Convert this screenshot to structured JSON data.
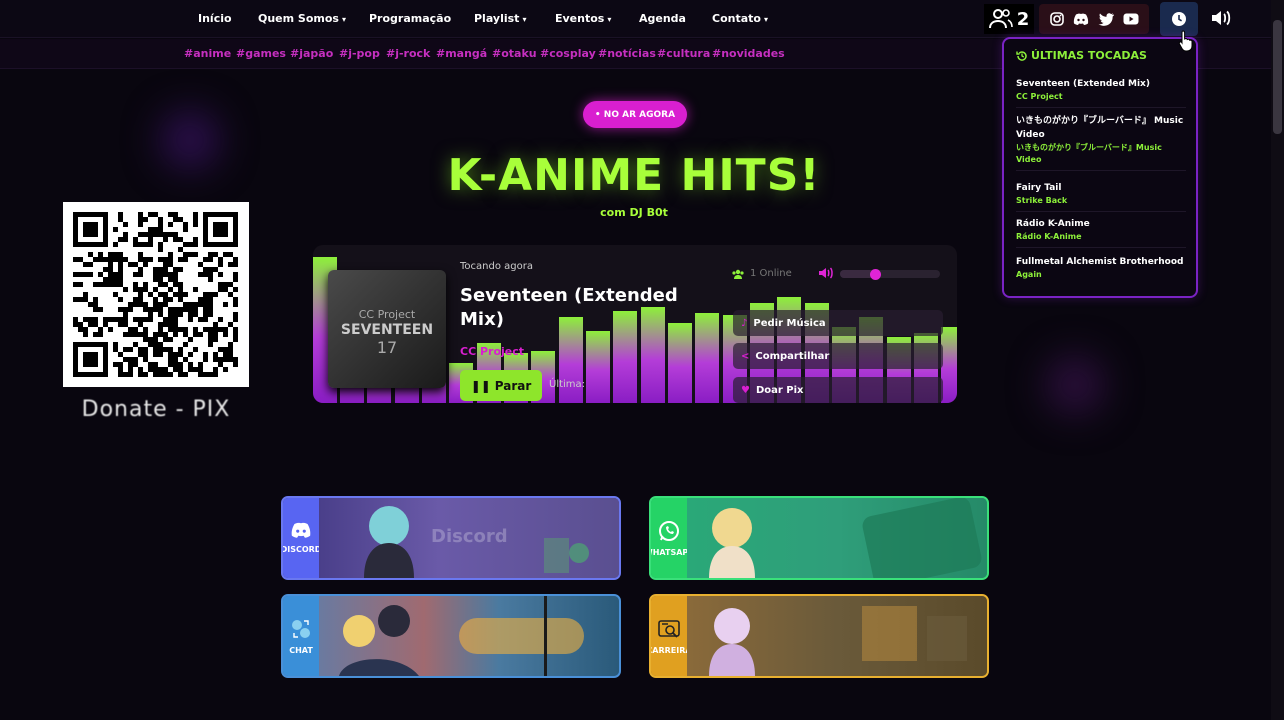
{
  "nav": {
    "items": [
      {
        "label": "Início",
        "dropdown": false
      },
      {
        "label": "Quem Somos",
        "dropdown": true
      },
      {
        "label": "Programação",
        "dropdown": false
      },
      {
        "label": "Playlist",
        "dropdown": true
      },
      {
        "label": "Eventos",
        "dropdown": true
      },
      {
        "label": "Agenda",
        "dropdown": false
      },
      {
        "label": "Contato",
        "dropdown": true
      }
    ],
    "listeners_count": "2",
    "social": [
      "instagram-icon",
      "discord-icon",
      "twitter-icon",
      "youtube-icon"
    ]
  },
  "tags": [
    "#anime",
    "#games",
    "#japão",
    "#j-pop",
    "#j-rock",
    "#mangá",
    "#otaku",
    "#cosplay",
    "#notícias",
    "#cultura",
    "#novidades"
  ],
  "hero": {
    "live_badge": "• NO AR AGORA",
    "title": "K-ANIME HITS!",
    "subtitle": "com DJ B0t"
  },
  "donate": {
    "label": "Donate - PIX"
  },
  "player": {
    "now_playing_label": "Tocando agora",
    "song_title": "Seventeen (Extended Mix)",
    "song_artist": "CC Project",
    "stop_button": "Parar",
    "last_label": "Última:",
    "online": "1 Online",
    "volume": 0.35,
    "cover": {
      "brand": "CC Project",
      "title": "SEVENTEEN",
      "number": "17"
    },
    "buttons": [
      {
        "label": "Pedir Música",
        "icon": "music-request-icon"
      },
      {
        "label": "Compartilhar",
        "icon": "share-icon"
      },
      {
        "label": "Doar Pix",
        "icon": "heart-icon"
      }
    ]
  },
  "history": {
    "title": "ÚLTIMAS TOCADAS",
    "items": [
      {
        "song": "Seventeen (Extended Mix)",
        "artist": "CC Project"
      },
      {
        "song": "いきものがかり『ブルーバード』 Music Video",
        "artist": "いきものがかり『ブルーバード』Music Video"
      },
      {
        "song": "Fairy Tail",
        "artist": "Strike Back"
      },
      {
        "song": "Rádio K-Anime",
        "artist": "Rádio K-Anime"
      },
      {
        "song": "Fullmetal Alchemist Brotherhood",
        "artist": "Again"
      }
    ]
  },
  "cards": [
    {
      "label": "DISCORD",
      "watermark": "Discord",
      "icon": "discord-icon",
      "color": "#5865f2"
    },
    {
      "label": "WHATSAPP",
      "watermark": "",
      "icon": "whatsapp-icon",
      "color": "#25d366"
    },
    {
      "label": "CHAT",
      "watermark": "",
      "icon": "chat-icon",
      "color": "#3a8fd8"
    },
    {
      "label": "CARREIRA",
      "watermark": "",
      "icon": "career-icon",
      "color": "#e0a020"
    }
  ],
  "colors": {
    "accent_green": "#a8ff3a",
    "accent_pink": "#d91fd0",
    "accent_purple": "#7a23c4",
    "background": "#09060f"
  }
}
